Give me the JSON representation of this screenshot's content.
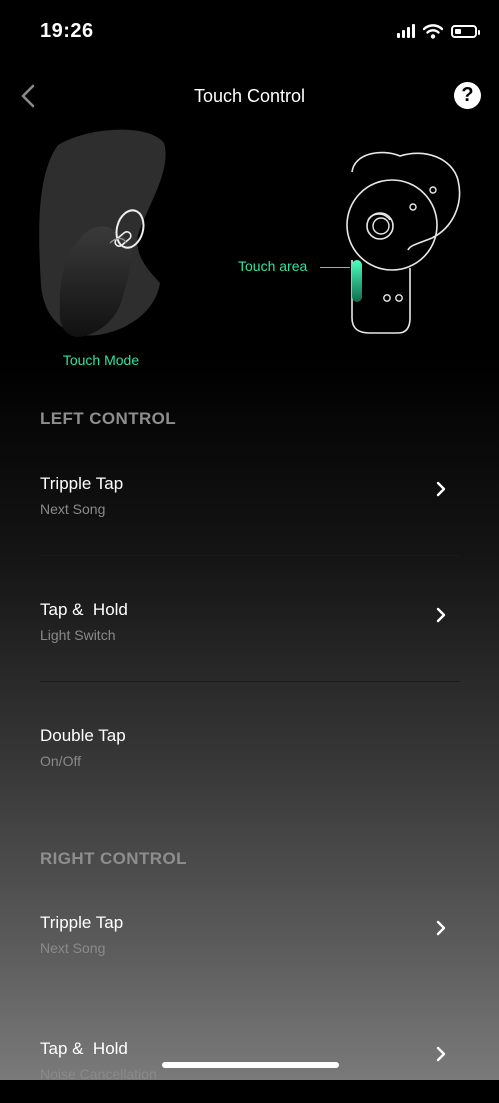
{
  "status_bar": {
    "time": "19:26"
  },
  "nav": {
    "title": "Touch Control",
    "help_glyph": "?"
  },
  "hero": {
    "touch_mode_label": "Touch Mode",
    "touch_area_label": "Touch area"
  },
  "colors": {
    "accent": "#2fe3a0",
    "secondary_text": "#8a8a8a",
    "section_header": "#8e8e8e"
  },
  "left_control": {
    "header": "LEFT CONTROL",
    "items": [
      {
        "title": "Tripple Tap",
        "value": "Next Song"
      },
      {
        "title": "Tap &  Hold",
        "value": "Light Switch"
      },
      {
        "title": "Double Tap",
        "value": "On/Off"
      }
    ]
  },
  "right_control": {
    "header": "RIGHT CONTROL",
    "items": [
      {
        "title": "Tripple Tap",
        "value": "Next Song"
      },
      {
        "title": "Tap &  Hold",
        "value": "Noise Cancellation"
      }
    ]
  }
}
